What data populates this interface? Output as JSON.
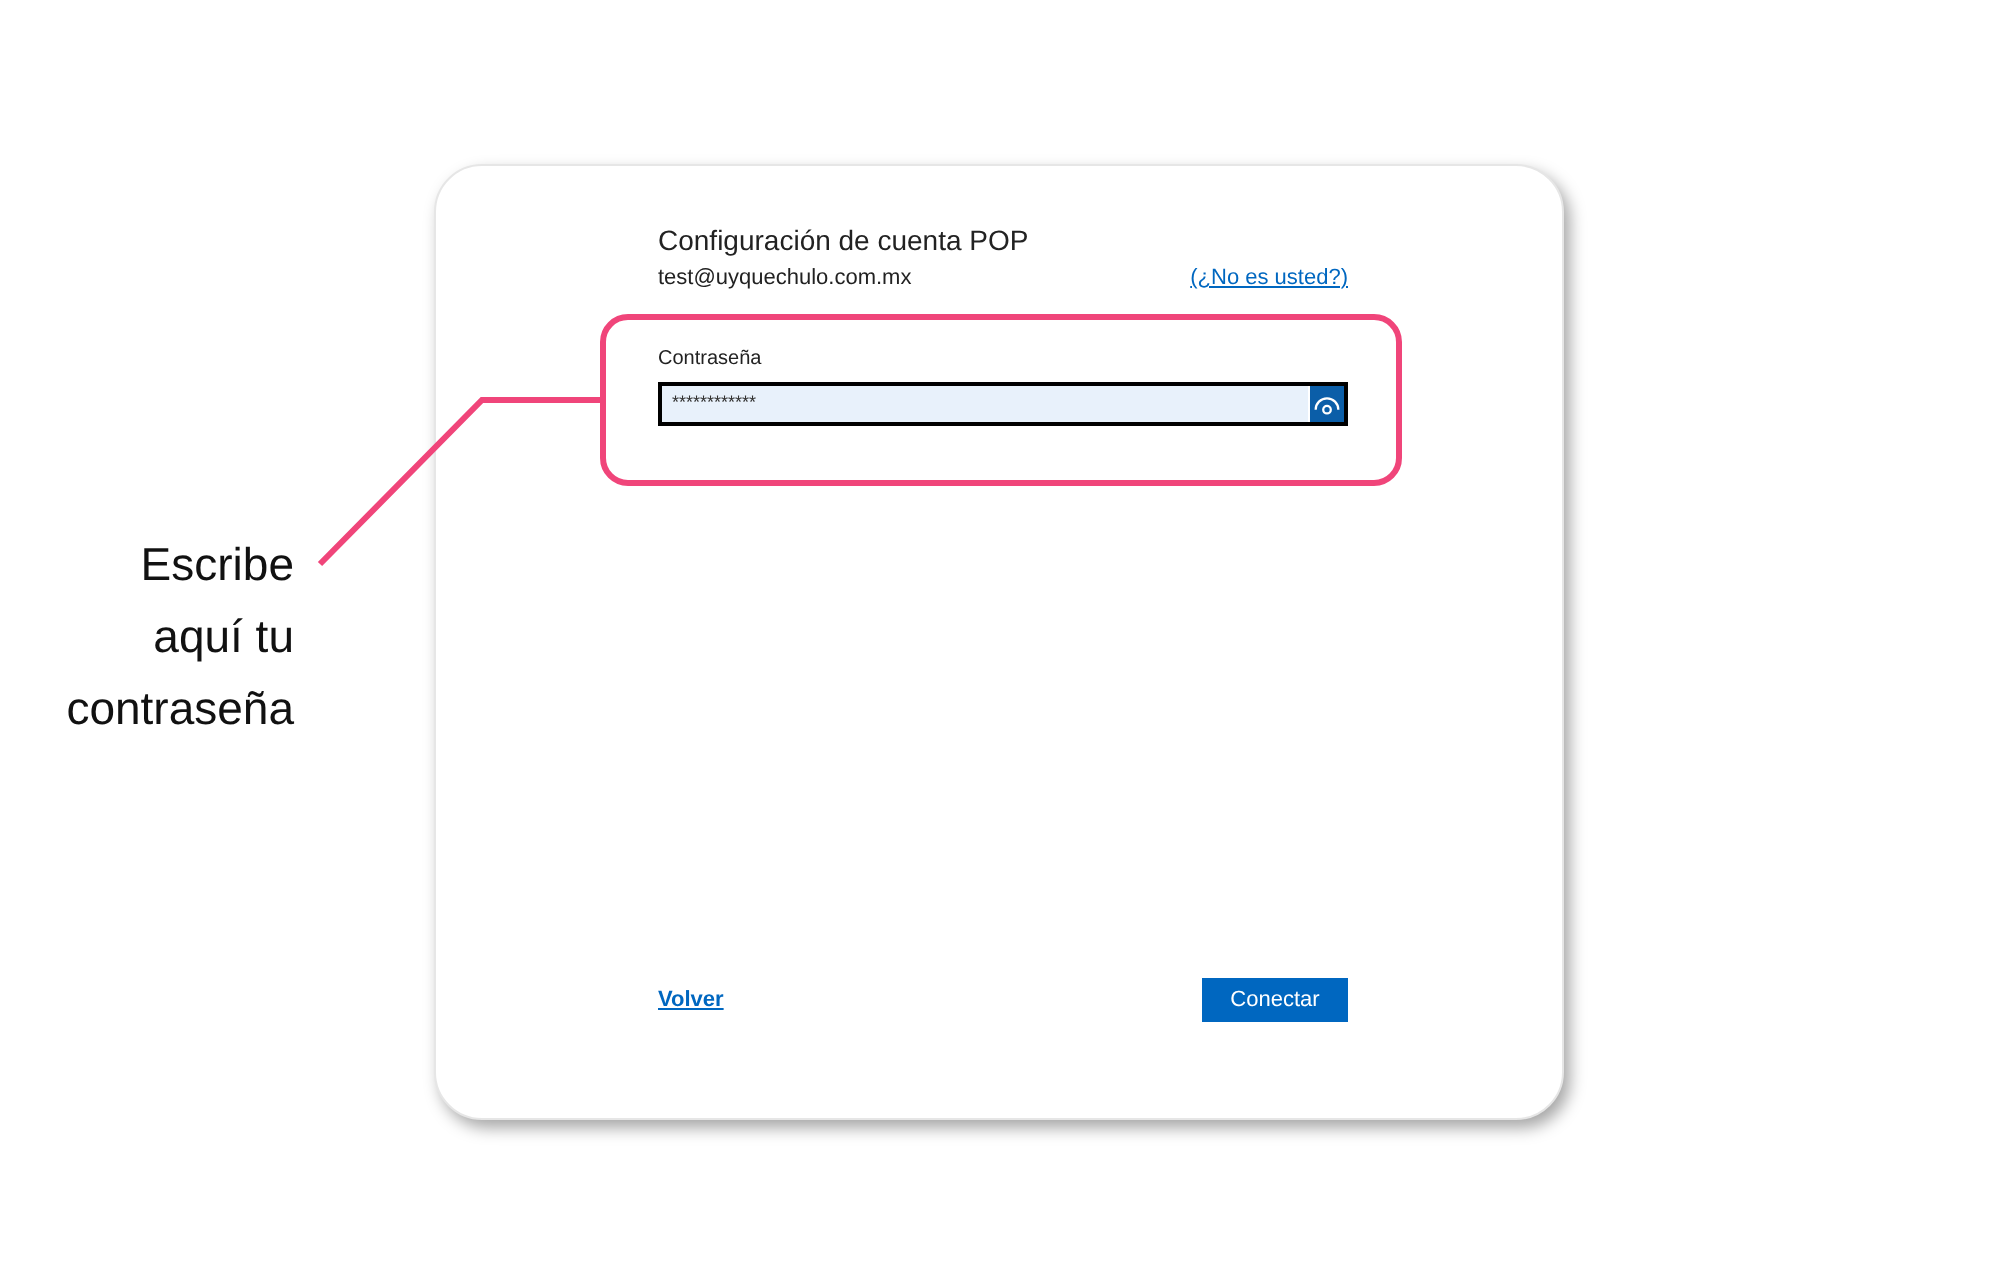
{
  "dialog": {
    "title": "Configuración de cuenta POP",
    "email": "test@uyquechulo.com.mx",
    "not_you_link": "(¿No es usted?)",
    "password": {
      "label": "Contraseña",
      "value": "************"
    },
    "back_link": "Volver",
    "connect_button": "Conectar"
  },
  "annotation": {
    "text": "Escribe aquí tu contraseña"
  }
}
